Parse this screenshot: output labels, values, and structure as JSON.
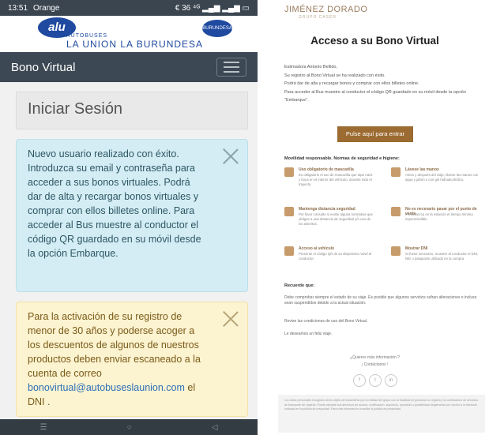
{
  "phone": {
    "status": {
      "time": "13:51",
      "carrier": "Orange",
      "right": "€ 36 ⁴ᴳ ▂▄▆ ▂▄▆ ▭"
    },
    "logo": {
      "badge": "alu",
      "small": "AUTOBUSES",
      "big": "LA UNION LA BURUNDESA",
      "seal": "BURUNDESA"
    },
    "navbar_title": "Bono Virtual",
    "login_title": "Iniciar Sesión",
    "alert_info": "Nuevo usuario realizado con éxito. Introduzca su email y contraseña para acceder a sus bonos virtuales. Podrá dar de alta y recargar bonos virtuales y comprar con ellos billetes online. Para acceder al Bus muestre al conductor el código QR guardado en su móvil desde la opción Embarque.",
    "alert_warn_pre": "Para la activación de su registro de menor de 30 años y poderse acoger a los descuentos de algunos de nuestros productos deben enviar escaneado a la cuenta de correo",
    "alert_warn_email": "bonovirtual@autobuseslaunion.com",
    "alert_warn_post": "el DNI ."
  },
  "email": {
    "brand": "JIMÉNEZ DORADO",
    "brand_sub": "GRUPO CASER",
    "title": "Acceso a su Bono Virtual",
    "intro": [
      "Estimado/a Antonio Bellido,",
      "Su registro al Bono Virtual se ha realizado con éxito.",
      "Podrá dar de alta y recargar bonos y comprar con ellos billetes online.",
      "Para acceder al Bus muestre al conductor el código QR guardado en su móvil desde la opción \"Embarque\"."
    ],
    "button": "Pulse aquí para entrar",
    "measures_title": "Movilidad responsable. Normas de seguridad e higiene:",
    "measures": [
      {
        "title": "Uso obligatorio de mascarilla",
        "desc": "Es obligatorio el uso de mascarilla que tape nariz y boca en el interior del vehículo, durante todo el trayecto."
      },
      {
        "title": "Lávese las manos",
        "desc": "Antes y después del viaje, lávese las manos con agua y jabón o con gel hidroalcohólico."
      },
      {
        "title": "Mantenga distancia seguridad",
        "desc": "Por favor consulte si existe alguna normativa que obligue a una distancia de seguridad y/o uso de los asientos."
      },
      {
        "title": "No es necesario pasar por el punto de venta",
        "desc": "Permanezca en la estación el tiempo mínimo imprescindible."
      },
      {
        "title": "Acceso al vehículo",
        "desc": "Presente el código QR de su dispositivo móvil al conductor."
      },
      {
        "title": "Mostrar DNI",
        "desc": "Si fuese necesario, muestre al conductor el DNI, NIE o pasaporte utilizado en la compra."
      }
    ],
    "recuerde_title": "Recuerde que:",
    "recuerde_text": "Debe comprobar siempre el estado de su viaje. Es posible que algunos servicios sufran alteraciones o incluso sean suspendidos debido a la actual situación.",
    "conditions": "Revise las condiciones de uso del Bono Virtual.",
    "farewell": "Le deseamos un feliz viaje.",
    "more_info": "¿Quieres más información ?",
    "greeting": "¡ Contáctanos !",
    "social": [
      "f",
      "t",
      "in"
    ],
    "footer": "Los datos personales recogidos serán objeto de tratamiento por la entidad del grupo con la finalidad de gestionar su registro y la contratación de servicios de transporte de viajeros. Puede ejercitar sus derechos de acceso, rectificación, supresión, oposición o portabilidad dirigiéndose por escrito a la dirección indicada en la política de privacidad. Para más información consulte la política de privacidad."
  }
}
